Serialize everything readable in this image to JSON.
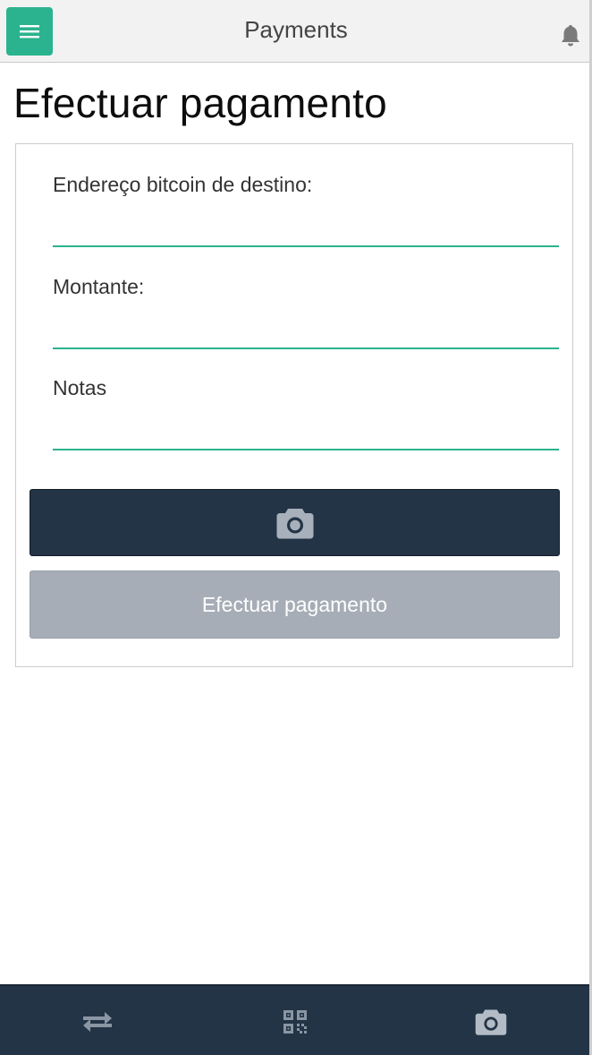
{
  "header": {
    "title": "Payments",
    "menu_icon": "hamburger-menu-icon",
    "notification_icon": "bell-icon"
  },
  "main": {
    "heading": "Efectuar pagamento",
    "form": {
      "address_label": "Endereço bitcoin de destino:",
      "address_value": "",
      "amount_label": "Montante:",
      "amount_value": "",
      "notes_label": "Notas",
      "notes_value": "",
      "scan_button_icon": "camera-icon",
      "submit_label": "Efectuar pagamento"
    }
  },
  "bottom_nav": {
    "items": [
      {
        "icon": "transfer-arrows-icon"
      },
      {
        "icon": "qr-code-icon"
      },
      {
        "icon": "camera-icon"
      }
    ]
  },
  "colors": {
    "accent": "#2bb38f",
    "dark": "#233446",
    "disabled_button": "#a7adb6"
  }
}
